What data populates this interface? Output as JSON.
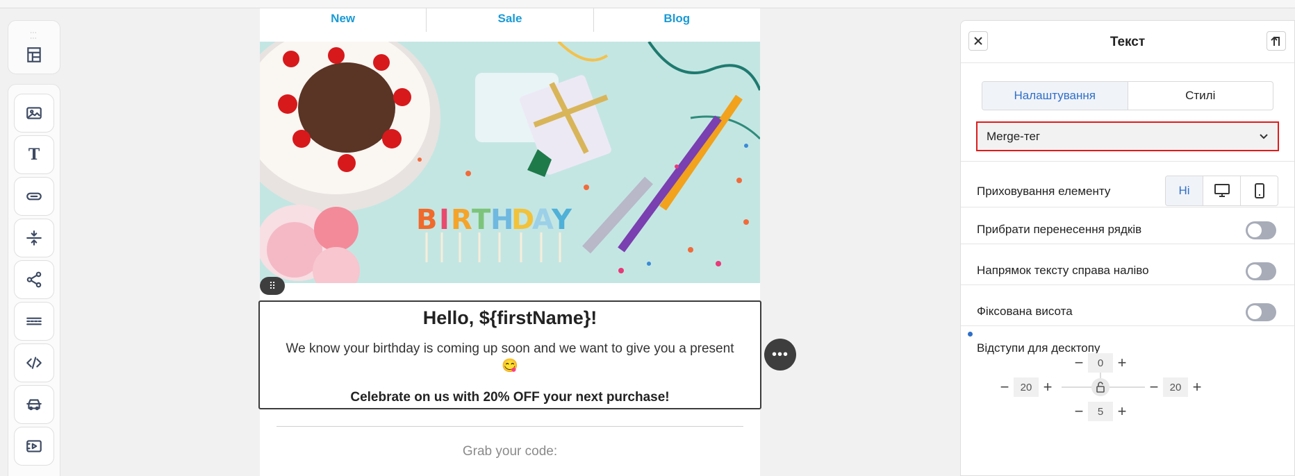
{
  "email": {
    "nav": [
      "New",
      "Sale",
      "Blog"
    ],
    "hero_letters": [
      "B",
      "I",
      "R",
      "T",
      "H",
      "D",
      "A",
      "Y"
    ],
    "greeting": "Hello, ${firstName}!",
    "body_text": "We know your birthday is coming up soon and we want to give you a present",
    "emoji": "😋",
    "promo": "Celebrate on us with 20% OFF your next purchase!",
    "code_label": "Grab your code:"
  },
  "panel": {
    "title": "Текст",
    "tabs": [
      "Налаштування",
      "Стилі"
    ],
    "merge_tag": "Merge-тег",
    "hide_label": "Приховування елементу",
    "hide_no": "Ні",
    "nowrap_label": "Прибрати перенесення рядків",
    "rtl_label": "Напрямок тексту справа наліво",
    "fixed_height_label": "Фіксована висота",
    "padding_label": "Відступи для десктопу",
    "padding": {
      "top": "0",
      "left": "20",
      "right": "20",
      "bottom": "5"
    }
  },
  "colors": {
    "link": "#1a9ad6",
    "accent": "#2f6fc7",
    "highlight_border": "#e01b1b",
    "toggle_off": "#a7acb8"
  },
  "toolbar_icons": [
    "layout-icon",
    "image-icon",
    "text-icon",
    "button-icon",
    "spacer-icon",
    "social-icon",
    "divider-icon",
    "html-icon",
    "product-icon",
    "video-icon"
  ]
}
